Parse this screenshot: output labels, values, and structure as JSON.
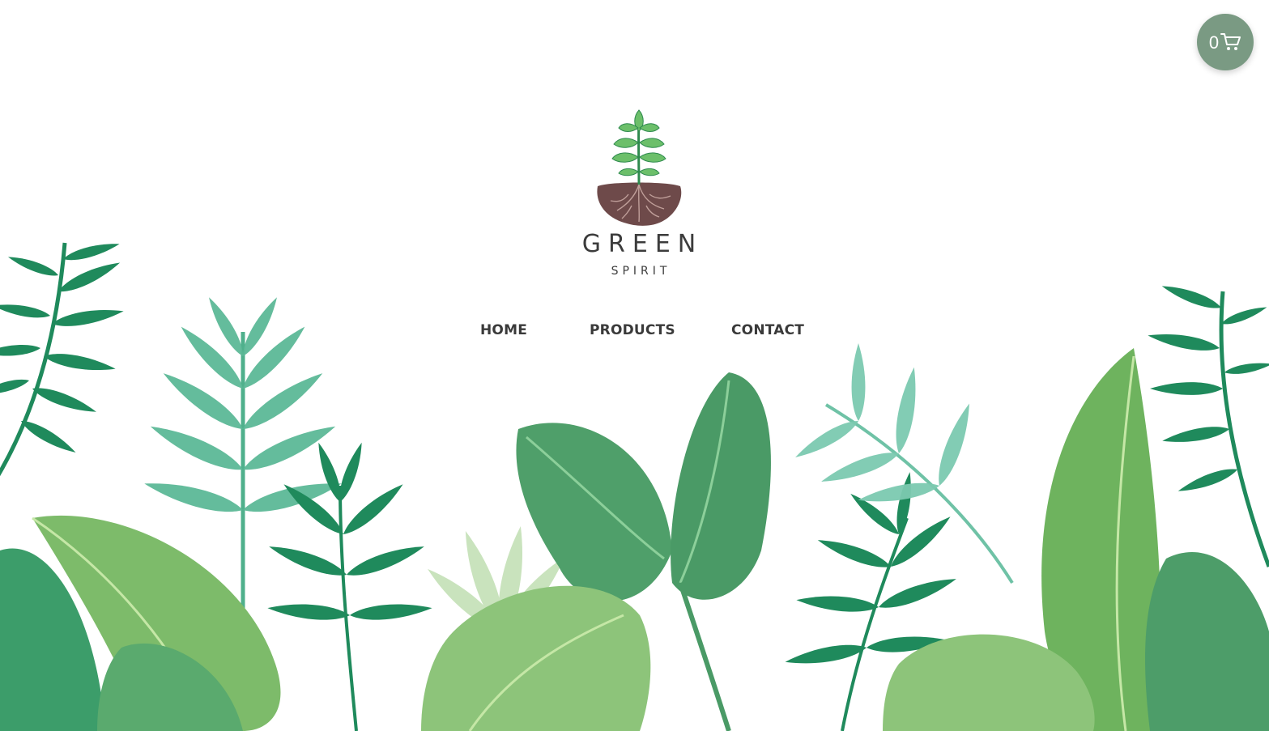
{
  "brand": {
    "name": "GREEN",
    "tagline": "SPIRIT",
    "logo_icon": "sprout-with-roots-icon"
  },
  "cart": {
    "count": "0",
    "icon": "shopping-cart-icon",
    "background_color": "#7a9a83"
  },
  "nav": {
    "items": [
      {
        "label": "HOME"
      },
      {
        "label": "PRODUCTS"
      },
      {
        "label": "CONTACT"
      }
    ]
  },
  "colors": {
    "text": "#3a3a3a",
    "leaf_dark": "#1f8a5c",
    "leaf_mid": "#3fa77a",
    "leaf_light": "#8cc79a",
    "leaf_pale": "#c4e0b6",
    "soil": "#6e4a4a"
  }
}
